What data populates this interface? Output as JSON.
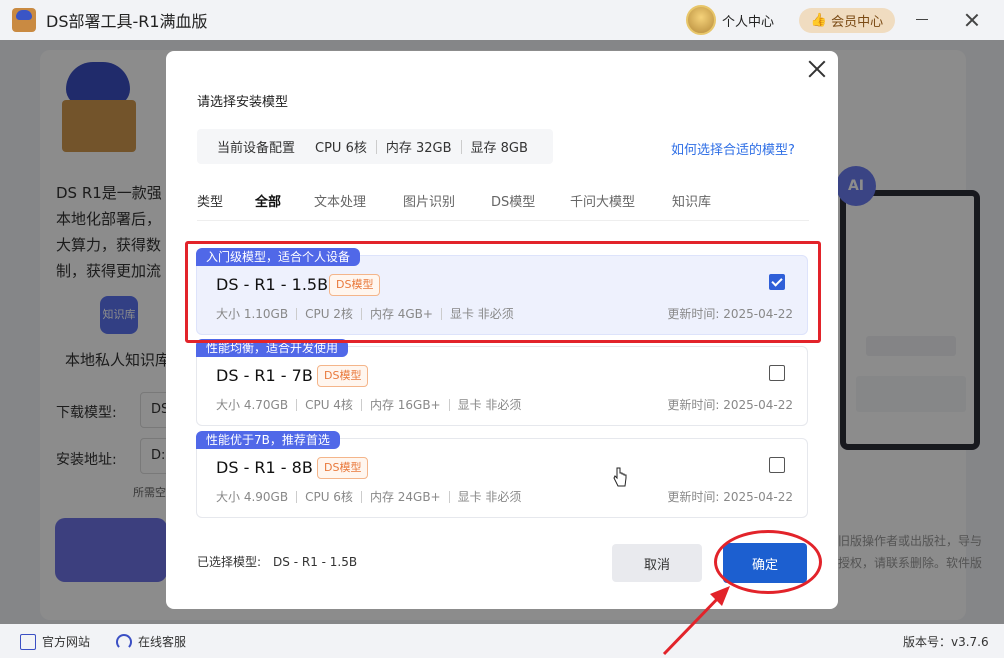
{
  "window": {
    "title": "DS部署工具-R1满血版",
    "user_center": "个人中心",
    "member_center": "会员中心"
  },
  "background": {
    "description": "DS R1是一款强 本地化部署后， 大算力，获得数 制，获得更加流",
    "kb_icon_text": "知识库",
    "kb_label": "本地私人知识库",
    "download_label": "下载模型:",
    "download_value": "DS",
    "install_label": "安装地址:",
    "install_value": "D:",
    "note": "所需空",
    "right_text": "旧版操作者或出版社，导与 授权，请联系删除。软件版",
    "ai_badge": "AI"
  },
  "footer": {
    "website": "官方网站",
    "support": "在线客服",
    "version": "版本号：v3.7.6"
  },
  "dialog": {
    "title": "请选择安装模型",
    "device": {
      "heading": "当前设备配置",
      "cpu": "CPU 6核",
      "memory": "内存 32GB",
      "vram": "显存 8GB"
    },
    "help_link": "如何选择合适的模型?",
    "filters": {
      "type_label": "类型",
      "items": [
        "全部",
        "文本处理",
        "图片识别",
        "DS模型",
        "千问大模型",
        "知识库"
      ],
      "active": "全部"
    },
    "models": [
      {
        "tag": "入门级模型，适合个人设备",
        "name": "DS - R1 - 1.5B",
        "badge": "DS模型",
        "size": "大小 1.10GB",
        "cpu": "CPU 2核",
        "memory": "内存 4GB+",
        "gpu": "显卡 非必须",
        "updated": "更新时间:  2025-04-22",
        "checked": true
      },
      {
        "tag": "性能均衡，适合开发使用",
        "name": "DS - R1 - 7B",
        "badge": "DS模型",
        "size": "大小 4.70GB",
        "cpu": "CPU 4核",
        "memory": "内存 16GB+",
        "gpu": "显卡 非必须",
        "updated": "更新时间:  2025-04-22",
        "checked": false
      },
      {
        "tag": "性能优于7B，推荐首选",
        "name": "DS - R1 - 8B",
        "badge": "DS模型",
        "size": "大小 4.90GB",
        "cpu": "CPU 6核",
        "memory": "内存 24GB+",
        "gpu": "显卡 非必须",
        "updated": "更新时间:  2025-04-22",
        "checked": false
      }
    ],
    "selected_label": "已选择模型:",
    "selected_value": "DS - R1 - 1.5B",
    "cancel": "取消",
    "confirm": "确定"
  },
  "colors": {
    "primary": "#1c5fd0",
    "tag": "#5068e8",
    "badge": "#e9793c",
    "annotation": "#e2232a"
  }
}
